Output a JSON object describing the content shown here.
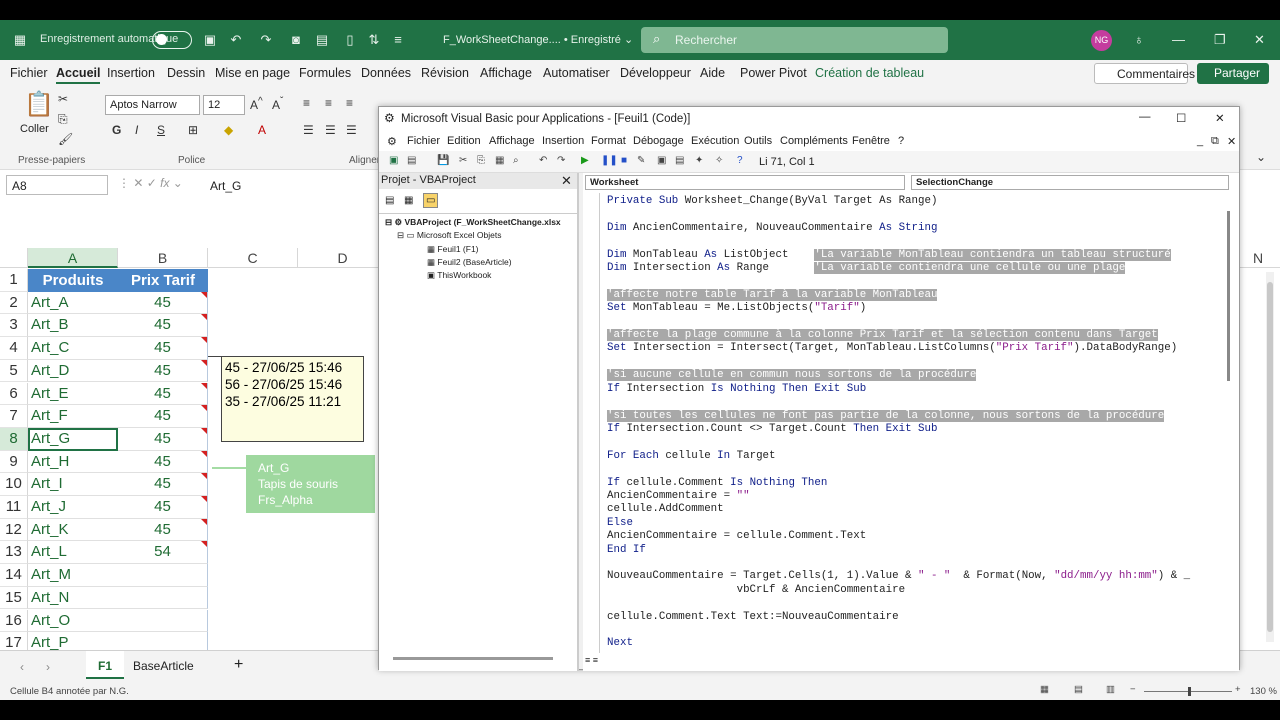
{
  "titlebar": {
    "autosave": "Enregistrement automatique",
    "doc": "F_WorkSheetChange.... • Enregistré ⌄",
    "search": "Rechercher",
    "avatar": "NG"
  },
  "menu": [
    "Fichier",
    "Accueil",
    "Insertion",
    "Dessin",
    "Mise en page",
    "Formules",
    "Données",
    "Révision",
    "Affichage",
    "Automatiser",
    "Développeur",
    "Aide",
    "Power Pivot",
    "Création de tableau"
  ],
  "menu_right": {
    "comments": "Commentaires",
    "share": "Partager"
  },
  "ribbon": {
    "paste": "Coller",
    "clipboard": "Presse-papiers",
    "font_group": "Police",
    "align_group": "Alignem",
    "font": "Aptos Narrow",
    "size": "12"
  },
  "formula": {
    "namebox": "A8",
    "content": "Art_G"
  },
  "columns": [
    "A",
    "B",
    "C",
    "D"
  ],
  "col_n": "N",
  "table": {
    "h1": "Produits",
    "h2": "Prix Tarif"
  },
  "rows": [
    {
      "n": "1"
    },
    {
      "n": "2",
      "a": "Art_A",
      "b": "45"
    },
    {
      "n": "3",
      "a": "Art_B",
      "b": "45"
    },
    {
      "n": "4",
      "a": "Art_C",
      "b": "45"
    },
    {
      "n": "5",
      "a": "Art_D",
      "b": "45"
    },
    {
      "n": "6",
      "a": "Art_E",
      "b": "45"
    },
    {
      "n": "7",
      "a": "Art_F",
      "b": "45"
    },
    {
      "n": "8",
      "a": "Art_G",
      "b": "45"
    },
    {
      "n": "9",
      "a": "Art_H",
      "b": "45"
    },
    {
      "n": "10",
      "a": "Art_I",
      "b": "45"
    },
    {
      "n": "11",
      "a": "Art_J",
      "b": "45"
    },
    {
      "n": "12",
      "a": "Art_K",
      "b": "45"
    },
    {
      "n": "13",
      "a": "Art_L",
      "b": "54"
    },
    {
      "n": "14",
      "a": "Art_M",
      "b": ""
    },
    {
      "n": "15",
      "a": "Art_N",
      "b": ""
    },
    {
      "n": "16",
      "a": "Art_O",
      "b": ""
    },
    {
      "n": "17",
      "a": "Art_P",
      "b": ""
    }
  ],
  "comment": [
    "45 - 27/06/25 15:46",
    "56 - 27/06/25 15:46",
    "35 - 27/06/25 11:21"
  ],
  "tooltip": [
    "Art_G",
    "Tapis de souris",
    "Frs_Alpha"
  ],
  "tabs": {
    "f1": "F1",
    "base": "BaseArticle",
    "add": "+"
  },
  "status": {
    "left": "Cellule B4 annotée par N.G.",
    "zoom": "130 %"
  },
  "vba": {
    "title": "Microsoft Visual Basic pour Applications - [Feuil1 (Code)]",
    "menu": [
      "Fichier",
      "Edition",
      "Affichage",
      "Insertion",
      "Format",
      "Débogage",
      "Exécution",
      "Outils",
      "Compléments",
      "Fenêtre",
      "?"
    ],
    "position": "Li 71, Col 1",
    "project_title": "Projet - VBAProject",
    "tree": [
      "VBAProject (F_WorkSheetChange.xlsx",
      "Microsoft Excel Objets",
      "Feuil1 (F1)",
      "Feuil2 (BaseArticle)",
      "ThisWorkbook"
    ],
    "object": "Worksheet",
    "procedure": "SelectionChange",
    "code": [
      [
        [
          "kw",
          "Private Sub "
        ],
        [
          "",
          ""
        ],
        [
          "",
          "Worksheet_Change(ByVal Target As Range)"
        ]
      ],
      [],
      [
        [
          "kw",
          "Dim "
        ],
        [
          "",
          "AncienCommentaire, NouveauCommentaire "
        ],
        [
          "kw",
          "As String"
        ]
      ],
      [],
      [
        [
          "kw",
          "Dim "
        ],
        [
          "",
          "MonTableau "
        ],
        [
          "kw",
          "As "
        ],
        [
          "",
          "ListObject    "
        ],
        [
          "cm",
          "'La variable MonTableau contiendra un tableau structuré"
        ]
      ],
      [
        [
          "kw",
          "Dim "
        ],
        [
          "",
          "Intersection "
        ],
        [
          "kw",
          "As "
        ],
        [
          "",
          "Range       "
        ],
        [
          "cm",
          "'La variable contiendra une cellule ou une plage"
        ]
      ],
      [],
      [
        [
          "cm",
          "'affecte notre table Tarif à la variable MonTableau"
        ]
      ],
      [
        [
          "kw",
          "Set "
        ],
        [
          "",
          "MonTableau = Me.ListObjects("
        ],
        [
          "pl",
          "\"Tarif\""
        ],
        [
          "",
          ")"
        ]
      ],
      [],
      [
        [
          "cm",
          "'affecte la plage commune à la colonne Prix Tarif et la sélection contenu dans Target"
        ]
      ],
      [
        [
          "kw",
          "Set "
        ],
        [
          "",
          "Intersection = Intersect(Target, MonTableau.ListColumns("
        ],
        [
          "pl",
          "\"Prix Tarif\""
        ],
        [
          "",
          ").DataBodyRange)"
        ]
      ],
      [],
      [
        [
          "cm",
          "'si aucune cellule en commun nous sortons de la procédure"
        ]
      ],
      [
        [
          "kw",
          "If "
        ],
        [
          "",
          "Intersection "
        ],
        [
          "kw",
          "Is Nothing Then Exit Sub"
        ]
      ],
      [],
      [
        [
          "cm",
          "'si toutes les cellules ne font pas partie de la colonne, nous sortons de la procédure"
        ]
      ],
      [
        [
          "kw",
          "If "
        ],
        [
          "",
          "Intersection.Count <> Target.Count "
        ],
        [
          "kw",
          "Then Exit Sub"
        ]
      ],
      [],
      [
        [
          "kw",
          "For Each "
        ],
        [
          "",
          "cellule "
        ],
        [
          "kw",
          "In "
        ],
        [
          "",
          "Target"
        ]
      ],
      [],
      [
        [
          "kw",
          "If "
        ],
        [
          "",
          "cellule.Comment "
        ],
        [
          "kw",
          "Is Nothing Then"
        ]
      ],
      [
        [
          "",
          "AncienCommentaire = "
        ],
        [
          "pl",
          "\"\""
        ]
      ],
      [
        [
          "",
          "cellule.AddComment"
        ]
      ],
      [
        [
          "kw",
          "Else"
        ]
      ],
      [
        [
          "",
          "AncienCommentaire = cellule.Comment.Text"
        ]
      ],
      [
        [
          "kw",
          "End If"
        ]
      ],
      [],
      [
        [
          "",
          "NouveauCommentaire = Target.Cells(1, 1).Value & "
        ],
        [
          "pl",
          "\" - \""
        ],
        [
          "",
          ""
        ],
        [
          "",
          "  & Format(Now, "
        ],
        [
          "pl",
          "\"dd/mm/yy hh:mm\""
        ],
        [
          "",
          ") & _"
        ]
      ],
      [
        [
          "",
          "                    vbCrLf & AncienCommentaire"
        ]
      ],
      [],
      [
        [
          "",
          "cellule.Comment.Text Text:=NouveauCommentaire"
        ]
      ],
      [],
      [
        [
          "kw",
          "Next"
        ]
      ]
    ]
  }
}
